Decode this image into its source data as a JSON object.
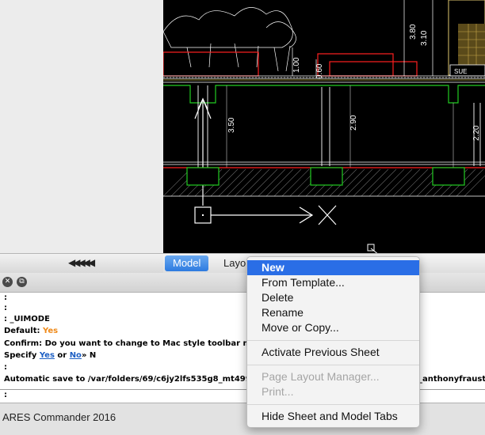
{
  "navigation": {
    "arrows": "◀◀◀◀◀"
  },
  "drawing": {
    "dimensions": [
      "3.50",
      "2.90",
      "2.20",
      "3.80",
      "3.10",
      "1.00",
      "0.60"
    ],
    "tag": "SUE"
  },
  "tabs": [
    {
      "label": "Model",
      "active": true
    },
    {
      "label": "Layo",
      "active": false
    }
  ],
  "command_window": {
    "close_glyph": "✕",
    "float_glyph": "⧉",
    "lines": [
      {
        "text": ":"
      },
      {
        "text": ":"
      },
      {
        "text": ": _UIMODE"
      },
      {
        "label": "Default: ",
        "value": "Yes"
      },
      {
        "text": "Confirm: Do you want to change to Mac style toolbar mo"
      },
      {
        "prefix": "Specify ",
        "opt1": "Yes",
        "mid": " or ",
        "opt2": "No",
        "suffix": "» N"
      },
      {
        "text": ":"
      },
      {
        "text": "Automatic save to /var/folders/69/c6jy2lfs535g8_mt499n",
        "tail": "_anthonyfraust"
      }
    ],
    "prompt": ":"
  },
  "status_bar": {
    "app_name": "ARES Commander 2016"
  },
  "context_menu": {
    "groups": [
      [
        {
          "label": "New",
          "highlighted": true,
          "enabled": true
        },
        {
          "label": "From Template...",
          "enabled": true
        },
        {
          "label": "Delete",
          "enabled": true
        },
        {
          "label": "Rename",
          "enabled": true
        },
        {
          "label": "Move or Copy...",
          "enabled": true
        }
      ],
      [
        {
          "label": "Activate Previous Sheet",
          "enabled": true
        }
      ],
      [
        {
          "label": "Page Layout Manager...",
          "enabled": false
        },
        {
          "label": "Print...",
          "enabled": false
        }
      ],
      [
        {
          "label": "Hide Sheet and Model Tabs",
          "enabled": true
        }
      ]
    ]
  },
  "colors": {
    "accent": "#2a6ee6",
    "prompt_value": "#ef8a1a",
    "link": "#1d5fc4",
    "cad_background": "#000000"
  }
}
